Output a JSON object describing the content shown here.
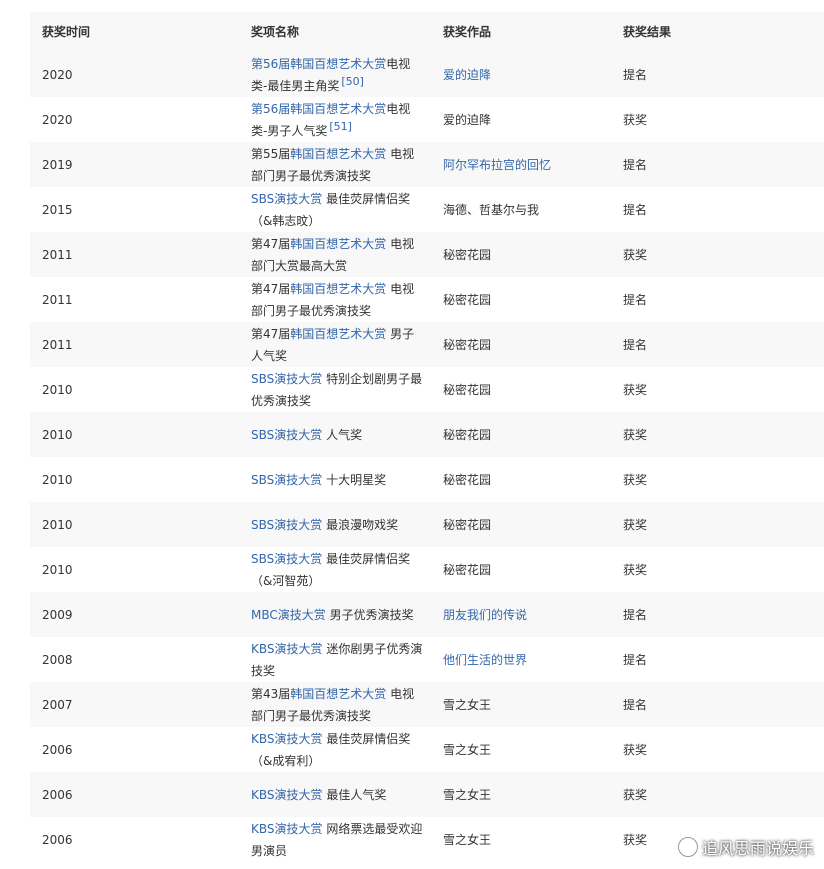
{
  "table": {
    "headers": [
      "获奖时间",
      "奖项名称",
      "获奖作品",
      "获奖结果"
    ],
    "rows": [
      {
        "year": "2020",
        "award_link": "第56届韩国百想艺术大赏",
        "award_pre": "",
        "award_text": "电视类-最佳男主角奖",
        "ref": "[50]",
        "work": "爱的迫降",
        "work_link": true,
        "result": "提名"
      },
      {
        "year": "2020",
        "award_link": "第56届韩国百想艺术大赏",
        "award_pre": "",
        "award_text": "电视类-男子人气奖",
        "ref": "[51]",
        "work": "爱的迫降",
        "work_link": false,
        "result": "获奖"
      },
      {
        "year": "2019",
        "award_link": "韩国百想艺术大赏",
        "award_pre": "第55届",
        "award_text": " 电视部门男子最优秀演技奖",
        "ref": "",
        "work": "阿尔罕布拉宫的回忆",
        "work_link": true,
        "result": "提名"
      },
      {
        "year": "2015",
        "award_link": "SBS演技大赏",
        "award_pre": "",
        "award_text": " 最佳荧屏情侣奖（&韩志旼）",
        "ref": "",
        "work": "海德、哲基尔与我",
        "work_link": false,
        "result": "提名"
      },
      {
        "year": "2011",
        "award_link": "韩国百想艺术大赏",
        "award_pre": "第47届",
        "award_text": " 电视部门大赏最高大赏",
        "ref": "",
        "work": "秘密花园",
        "work_link": false,
        "result": "获奖"
      },
      {
        "year": "2011",
        "award_link": "韩国百想艺术大赏",
        "award_pre": "第47届",
        "award_text": " 电视部门男子最优秀演技奖",
        "ref": "",
        "work": "秘密花园",
        "work_link": false,
        "result": "提名"
      },
      {
        "year": "2011",
        "award_link": "韩国百想艺术大赏",
        "award_pre": "第47届",
        "award_text": " 男子人气奖",
        "ref": "",
        "work": "秘密花园",
        "work_link": false,
        "result": "提名"
      },
      {
        "year": "2010",
        "award_link": "SBS演技大赏",
        "award_pre": "",
        "award_text": " 特别企划剧男子最优秀演技奖",
        "ref": "",
        "work": "秘密花园",
        "work_link": false,
        "result": "获奖"
      },
      {
        "year": "2010",
        "award_link": "SBS演技大赏",
        "award_pre": "",
        "award_text": " 人气奖",
        "ref": "",
        "work": "秘密花园",
        "work_link": false,
        "result": "获奖"
      },
      {
        "year": "2010",
        "award_link": "SBS演技大赏",
        "award_pre": "",
        "award_text": " 十大明星奖",
        "ref": "",
        "work": "秘密花园",
        "work_link": false,
        "result": "获奖"
      },
      {
        "year": "2010",
        "award_link": "SBS演技大赏",
        "award_pre": "",
        "award_text": " 最浪漫吻戏奖",
        "ref": "",
        "work": "秘密花园",
        "work_link": false,
        "result": "获奖"
      },
      {
        "year": "2010",
        "award_link": "SBS演技大赏",
        "award_pre": "",
        "award_text": " 最佳荧屏情侣奖（&河智苑）",
        "ref": "",
        "work": "秘密花园",
        "work_link": false,
        "result": "获奖"
      },
      {
        "year": "2009",
        "award_link": "MBC演技大赏",
        "award_pre": "",
        "award_text": " 男子优秀演技奖",
        "ref": "",
        "work": "朋友我们的传说",
        "work_link": true,
        "result": "提名"
      },
      {
        "year": "2008",
        "award_link": "KBS演技大赏",
        "award_pre": "",
        "award_text": " 迷你剧男子优秀演技奖",
        "ref": "",
        "work": "他们生活的世界",
        "work_link": true,
        "result": "提名"
      },
      {
        "year": "2007",
        "award_link": "韩国百想艺术大赏",
        "award_pre": "第43届",
        "award_text": " 电视部门男子最优秀演技奖",
        "ref": "",
        "work": "雪之女王",
        "work_link": false,
        "result": "提名"
      },
      {
        "year": "2006",
        "award_link": "KBS演技大赏",
        "award_pre": "",
        "award_text": " 最佳荧屏情侣奖（&成宥利）",
        "ref": "",
        "work": "雪之女王",
        "work_link": false,
        "result": "获奖"
      },
      {
        "year": "2006",
        "award_link": "KBS演技大赏",
        "award_pre": "",
        "award_text": " 最佳人气奖",
        "ref": "",
        "work": "雪之女王",
        "work_link": false,
        "result": "获奖"
      },
      {
        "year": "2006",
        "award_link": "KBS演技大赏",
        "award_pre": "",
        "award_text": " 网络票选最受欢迎男演员",
        "ref": "",
        "work": "雪之女王",
        "work_link": false,
        "result": "获奖"
      }
    ]
  },
  "watermark": {
    "text": "追风思雨说娱乐"
  },
  "colors": {
    "link": "#3366aa",
    "stripe": "#f8f8f8"
  }
}
